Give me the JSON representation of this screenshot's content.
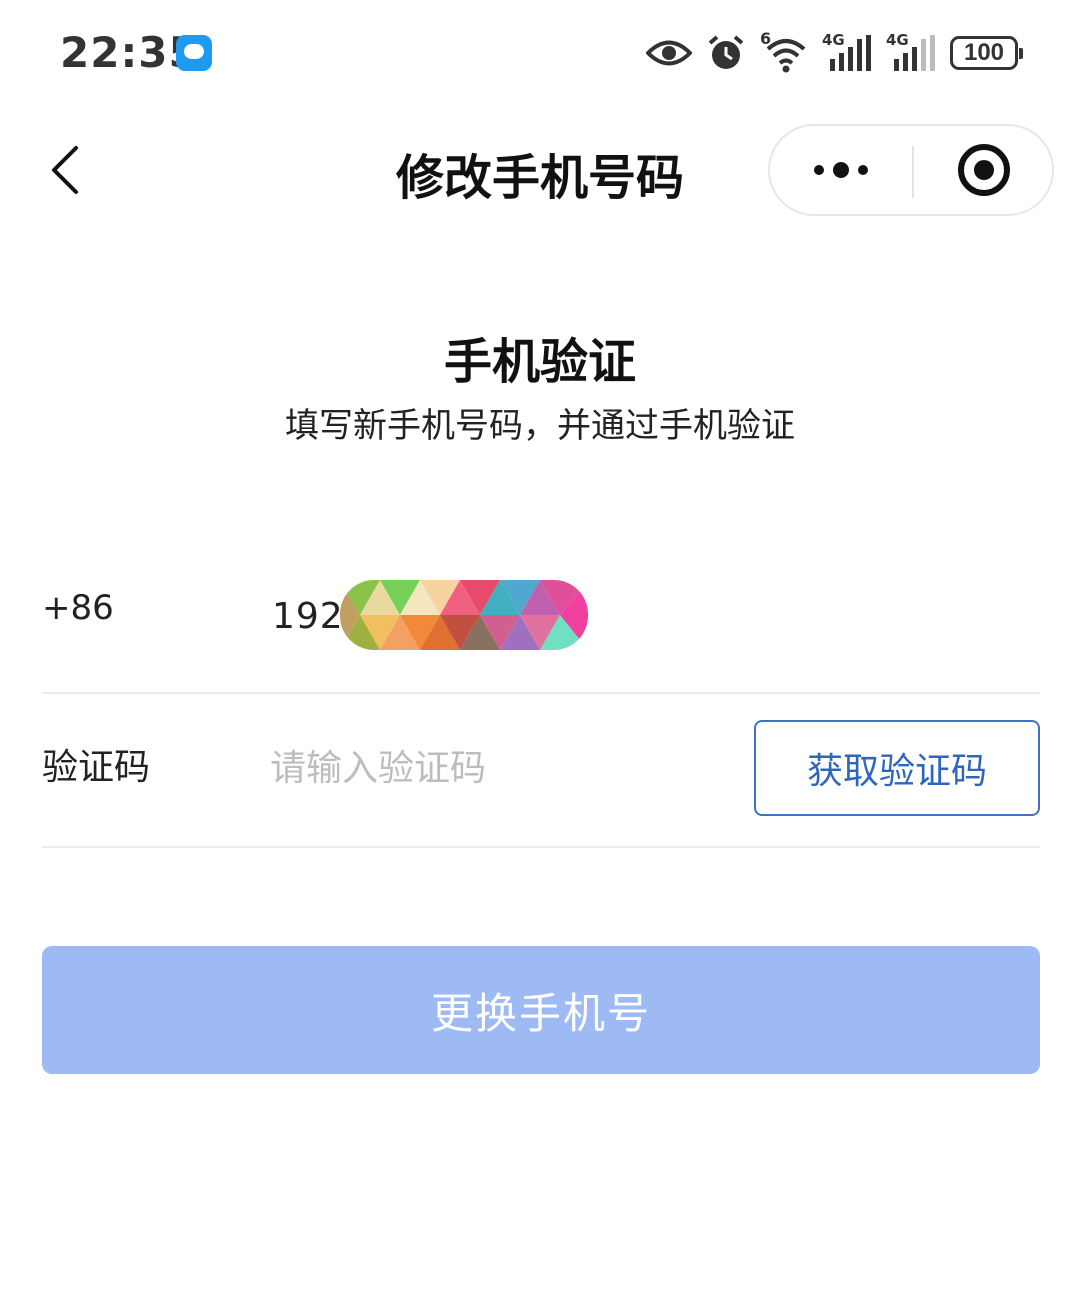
{
  "status_bar": {
    "time": "22:35",
    "battery": "100",
    "network_1": "4G",
    "network_2": "4G",
    "wifi_badge": "6"
  },
  "nav": {
    "title": "修改手机号码"
  },
  "heading": {
    "title": "手机验证",
    "subtitle": "填写新手机号码，并通过手机验证"
  },
  "form": {
    "country_code": "+86",
    "phone_visible": "192",
    "code_label": "验证码",
    "code_placeholder": "请输入验证码",
    "code_value": "",
    "get_code_label": "获取验证码"
  },
  "submit": {
    "label": "更换手机号"
  },
  "colors": {
    "accent": "#2f66bd",
    "submit_disabled": "#9dbaf5",
    "divider": "#ededed",
    "placeholder": "#bdbdbd"
  }
}
